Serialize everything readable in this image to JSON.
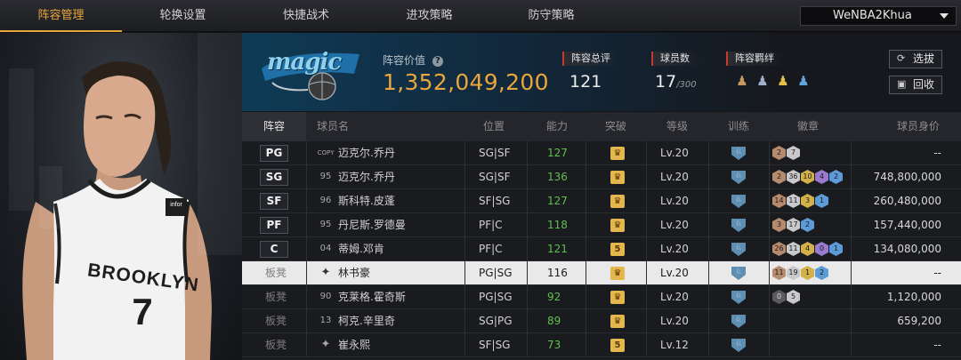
{
  "nav": {
    "tabs": [
      "阵容管理",
      "轮换设置",
      "快捷战术",
      "进攻策略",
      "防守策略"
    ],
    "active_tab": 0,
    "account": "WeNBA2Khua"
  },
  "team": {
    "logo_text": "magic",
    "value_label": "阵容价值",
    "value": "1,352,049,200",
    "overall_label": "阵容总评",
    "overall": "121",
    "players_label": "球员数",
    "players_count": "17",
    "players_max": "/300",
    "bond_label": "阵容羁绊",
    "bond_icons": [
      "bond-icon-1",
      "bond-icon-2",
      "bond-icon-3",
      "bond-icon-4"
    ]
  },
  "buttons": {
    "scout": "选拔",
    "recycle": "回收"
  },
  "table": {
    "headers": [
      "阵容",
      "球员名",
      "位置",
      "能力",
      "突破",
      "等级",
      "训练",
      "徽章",
      "球员身价"
    ],
    "rows": [
      {
        "pos": "PG",
        "num": "COPY",
        "name": "迈克尔.乔丹",
        "position": "SG|SF",
        "ovr": "127",
        "breakthrough": "crown",
        "level": "Lv.20",
        "medals": [
          [
            "m-bronze",
            "2"
          ],
          [
            "m-silver",
            "7"
          ]
        ],
        "salary": "--",
        "bench": false
      },
      {
        "pos": "SG",
        "num": "95",
        "name": "迈克尔.乔丹",
        "position": "SG|SF",
        "ovr": "136",
        "breakthrough": "crown",
        "level": "Lv.20",
        "medals": [
          [
            "m-bronze",
            "2"
          ],
          [
            "m-silver",
            "36"
          ],
          [
            "m-gold",
            "10"
          ],
          [
            "m-purple",
            "4"
          ],
          [
            "m-blue",
            "2"
          ]
        ],
        "salary": "748,800,000",
        "bench": false
      },
      {
        "pos": "SF",
        "num": "96",
        "name": "斯科特.皮蓬",
        "position": "SF|SG",
        "ovr": "127",
        "breakthrough": "crown",
        "level": "Lv.20",
        "medals": [
          [
            "m-bronze",
            "14"
          ],
          [
            "m-silver",
            "11"
          ],
          [
            "m-gold",
            "3"
          ],
          [
            "m-blue",
            "1"
          ]
        ],
        "salary": "260,480,000",
        "bench": false
      },
      {
        "pos": "PF",
        "num": "95",
        "name": "丹尼斯.罗德曼",
        "position": "PF|C",
        "ovr": "118",
        "breakthrough": "crown",
        "level": "Lv.20",
        "medals": [
          [
            "m-bronze",
            "3"
          ],
          [
            "m-silver",
            "17"
          ],
          [
            "m-blue",
            "2"
          ]
        ],
        "salary": "157,440,000",
        "bench": false
      },
      {
        "pos": "C",
        "num": "04",
        "name": "蒂姆.邓肯",
        "position": "PF|C",
        "ovr": "121",
        "breakthrough": "5",
        "level": "Lv.20",
        "medals": [
          [
            "m-bronze",
            "26"
          ],
          [
            "m-silver",
            "11"
          ],
          [
            "m-gold",
            "4"
          ],
          [
            "m-purple",
            "0"
          ],
          [
            "m-blue",
            "1"
          ]
        ],
        "salary": "134,080,000",
        "bench": false
      },
      {
        "pos": "板凳",
        "num": "",
        "name": "林书豪",
        "position": "PG|SG",
        "ovr": "116",
        "breakthrough": "crown",
        "level": "Lv.20",
        "medals": [
          [
            "m-bronze",
            "11"
          ],
          [
            "m-silver",
            "19"
          ],
          [
            "m-gold",
            "1"
          ],
          [
            "m-blue",
            "2"
          ]
        ],
        "salary": "--",
        "bench": true,
        "selected": true
      },
      {
        "pos": "板凳",
        "num": "90",
        "name": "克莱格.霍奇斯",
        "position": "PG|SG",
        "ovr": "92",
        "breakthrough": "crown",
        "level": "Lv.20",
        "medals": [
          [
            "m-dark",
            "0"
          ],
          [
            "m-silver",
            "5"
          ]
        ],
        "salary": "1,120,000",
        "bench": true
      },
      {
        "pos": "板凳",
        "num": "13",
        "name": "柯克.辛里奇",
        "position": "SG|PG",
        "ovr": "89",
        "breakthrough": "crown",
        "level": "Lv.20",
        "medals": [],
        "salary": "659,200",
        "bench": true
      },
      {
        "pos": "板凳",
        "num": "",
        "name": "崔永熙",
        "position": "SF|SG",
        "ovr": "73",
        "breakthrough": "5",
        "level": "Lv.12",
        "medals": [],
        "salary": "--",
        "bench": true
      }
    ]
  },
  "player": {
    "jersey_team": "BROOKLYN",
    "jersey_number": "7",
    "jersey_patch": "infor"
  },
  "colors": {
    "accent": "#e8a63c",
    "green": "#5fbf4f",
    "stat_marker": "#c43a31"
  }
}
